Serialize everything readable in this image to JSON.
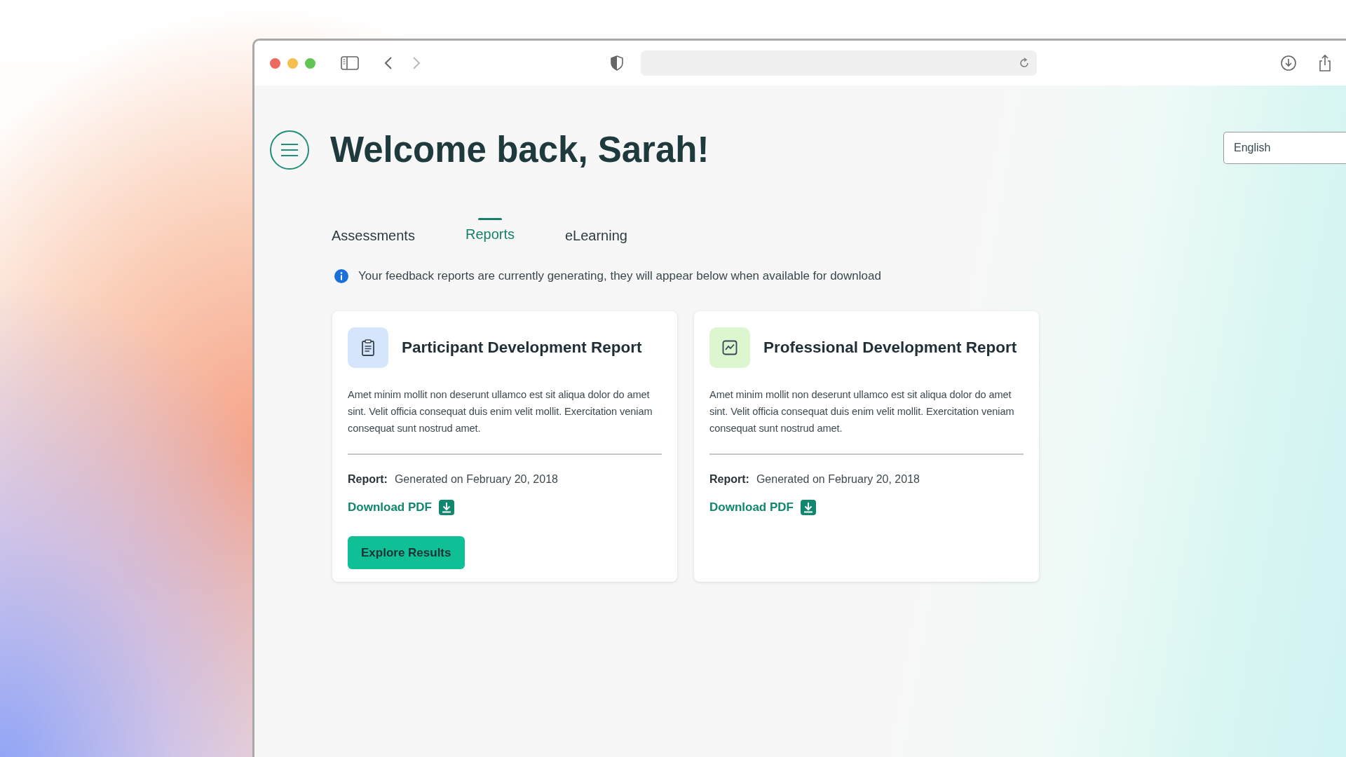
{
  "page": {
    "title": "Welcome back, Sarah!",
    "language": "English"
  },
  "tabs": [
    {
      "label": "Assessments",
      "selected": false
    },
    {
      "label": "Reports",
      "selected": true
    },
    {
      "label": "eLearning",
      "selected": false
    }
  ],
  "notice": "Your feedback reports are currently generating, they will appear below when available for download",
  "cards": [
    {
      "kind": "clipboard",
      "title": "Participant Development Report",
      "description": "Amet minim mollit non deserunt ullamco est sit aliqua dolor do amet sint. Velit officia consequat duis enim velit mollit. Exercitation veniam consequat sunt nostrud amet.",
      "report_label": "Report:",
      "report_value": "Generated on February 20, 2018",
      "download": "Download PDF",
      "button": "Explore Results"
    },
    {
      "kind": "chart",
      "title": "Professional Development Report",
      "description": "Amet minim mollit non deserunt ullamco est sit aliqua dolor do amet sint. Velit officia consequat duis enim velit mollit. Exercitation veniam consequat sunt nostrud amet.",
      "report_label": "Report:",
      "report_value": "Generated on February 20, 2018",
      "download": "Download PDF"
    }
  ]
}
